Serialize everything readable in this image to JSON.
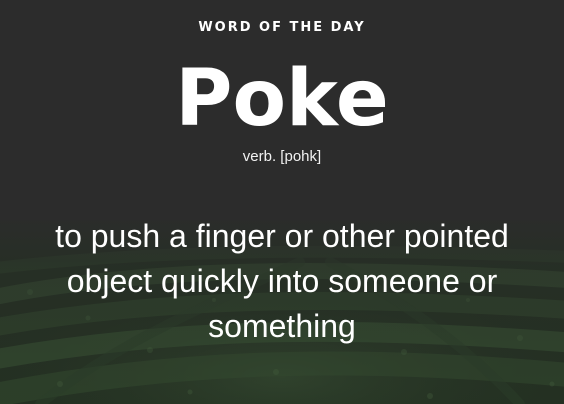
{
  "card": {
    "eyebrow": "WORD OF THE DAY",
    "word": "Poke",
    "pronunciation": "verb. [pohk]",
    "definition": "to push a finger or other pointed object quickly into someone or something"
  },
  "colors": {
    "background": "#2c2c2c",
    "text": "#ffffff",
    "foliage": "#2f4a2c"
  }
}
